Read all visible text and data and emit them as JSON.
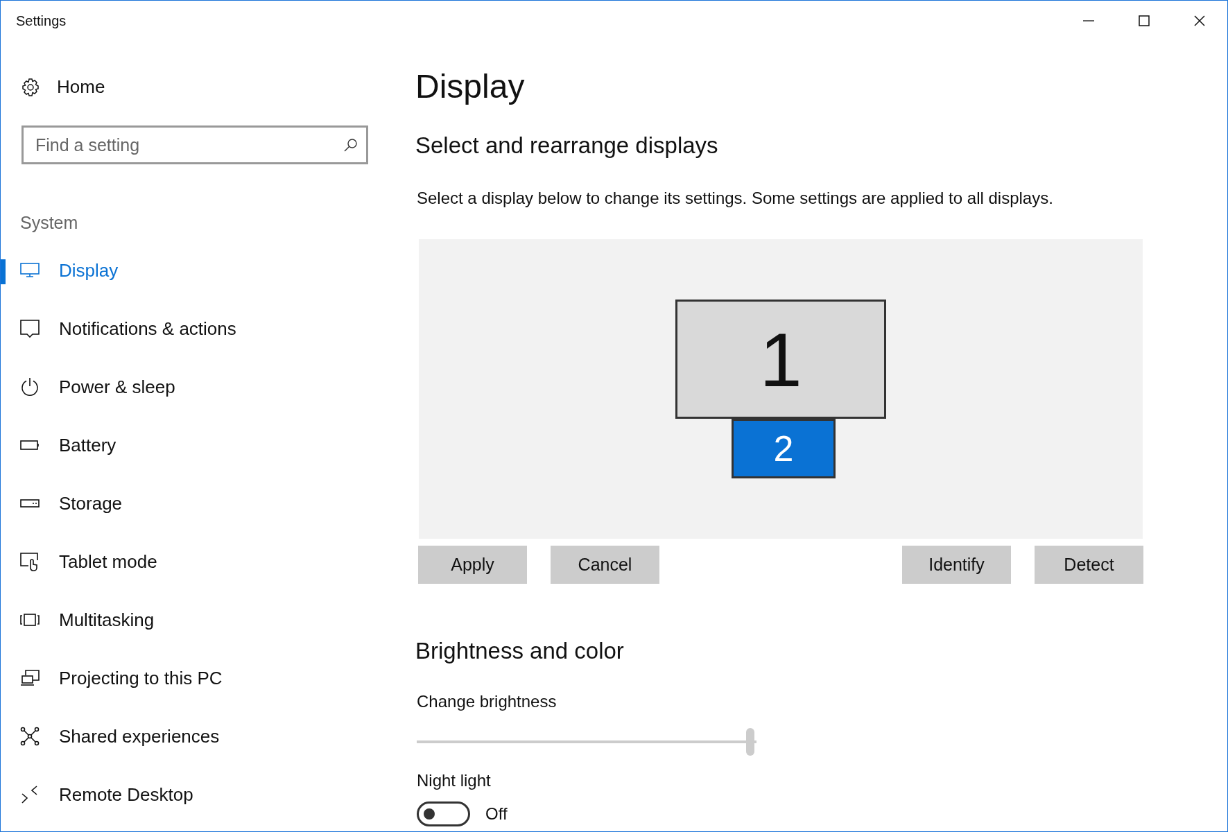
{
  "window": {
    "title": "Settings"
  },
  "sidebar": {
    "home": "Home",
    "search": {
      "placeholder": "Find a setting"
    },
    "section": "System",
    "items": [
      {
        "label": "Display",
        "kind": "monitor",
        "selected": true
      },
      {
        "label": "Notifications & actions",
        "kind": "bubble",
        "selected": false
      },
      {
        "label": "Power & sleep",
        "kind": "power",
        "selected": false
      },
      {
        "label": "Battery",
        "kind": "battery",
        "selected": false
      },
      {
        "label": "Storage",
        "kind": "storage",
        "selected": false
      },
      {
        "label": "Tablet mode",
        "kind": "tablet",
        "selected": false
      },
      {
        "label": "Multitasking",
        "kind": "multitask",
        "selected": false
      },
      {
        "label": "Projecting to this PC",
        "kind": "project",
        "selected": false
      },
      {
        "label": "Shared experiences",
        "kind": "shared",
        "selected": false
      },
      {
        "label": "Remote Desktop",
        "kind": "remote",
        "selected": false
      }
    ]
  },
  "page": {
    "title": "Display",
    "arrange": {
      "heading": "Select and rearrange displays",
      "description": "Select a display below to change its settings. Some settings are applied to all displays.",
      "displays": [
        {
          "label": "1",
          "kind": "large",
          "selected": false
        },
        {
          "label": "2",
          "kind": "small",
          "selected": true
        }
      ],
      "buttons_left": [
        "Apply",
        "Cancel"
      ],
      "buttons_right": [
        "Identify",
        "Detect"
      ]
    },
    "brightness": {
      "heading": "Brightness and color",
      "slider_label": "Change brightness",
      "level": 1.0,
      "night_light": {
        "label": "Night light",
        "on": false,
        "state_text": "Off"
      }
    }
  }
}
